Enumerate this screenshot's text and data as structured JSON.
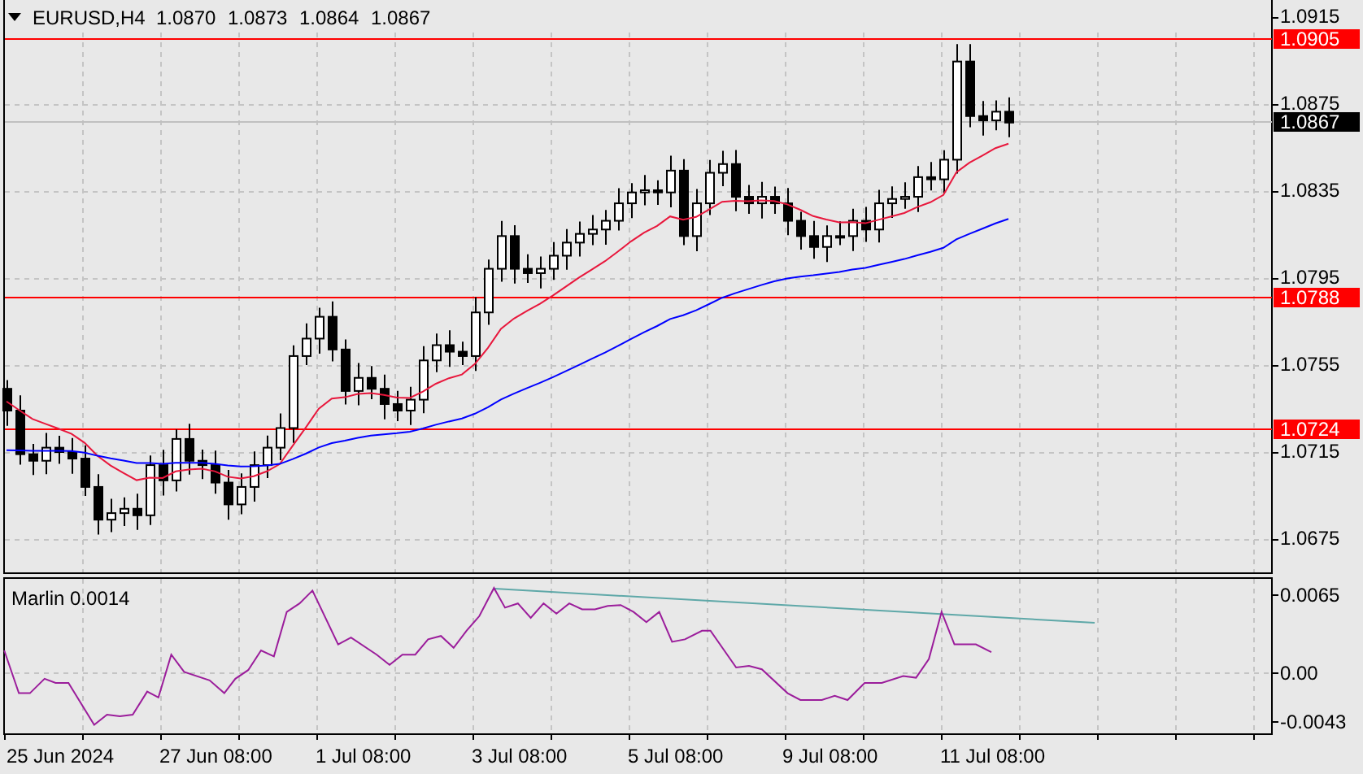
{
  "header": {
    "symbol": "EURUSD,H4",
    "ohlc": [
      "1.0870",
      "1.0873",
      "1.0864",
      "1.0867"
    ]
  },
  "price_axis": {
    "ticks": [
      "1.0915",
      "1.0875",
      "1.0835",
      "1.0795",
      "1.0755",
      "1.0715",
      "1.0675"
    ],
    "tags": [
      {
        "text": "1.0905",
        "kind": "level",
        "color": "#ff0000"
      },
      {
        "text": "1.0867",
        "kind": "current",
        "color": "#000000"
      },
      {
        "text": "1.0788",
        "kind": "level",
        "color": "#ff0000"
      },
      {
        "text": "1.0724",
        "kind": "level",
        "color": "#ff0000"
      }
    ]
  },
  "indicator": {
    "label": "Marlin 0.0014",
    "ticks": [
      "0.0065",
      "0.00",
      "-0.0043"
    ]
  },
  "time_axis": [
    "25 Jun 2024",
    "27 Jun 08:00",
    "1 Jul 08:00",
    "3 Jul 08:00",
    "5 Jul 08:00",
    "9 Jul 08:00",
    "11 Jul 08:00"
  ]
}
